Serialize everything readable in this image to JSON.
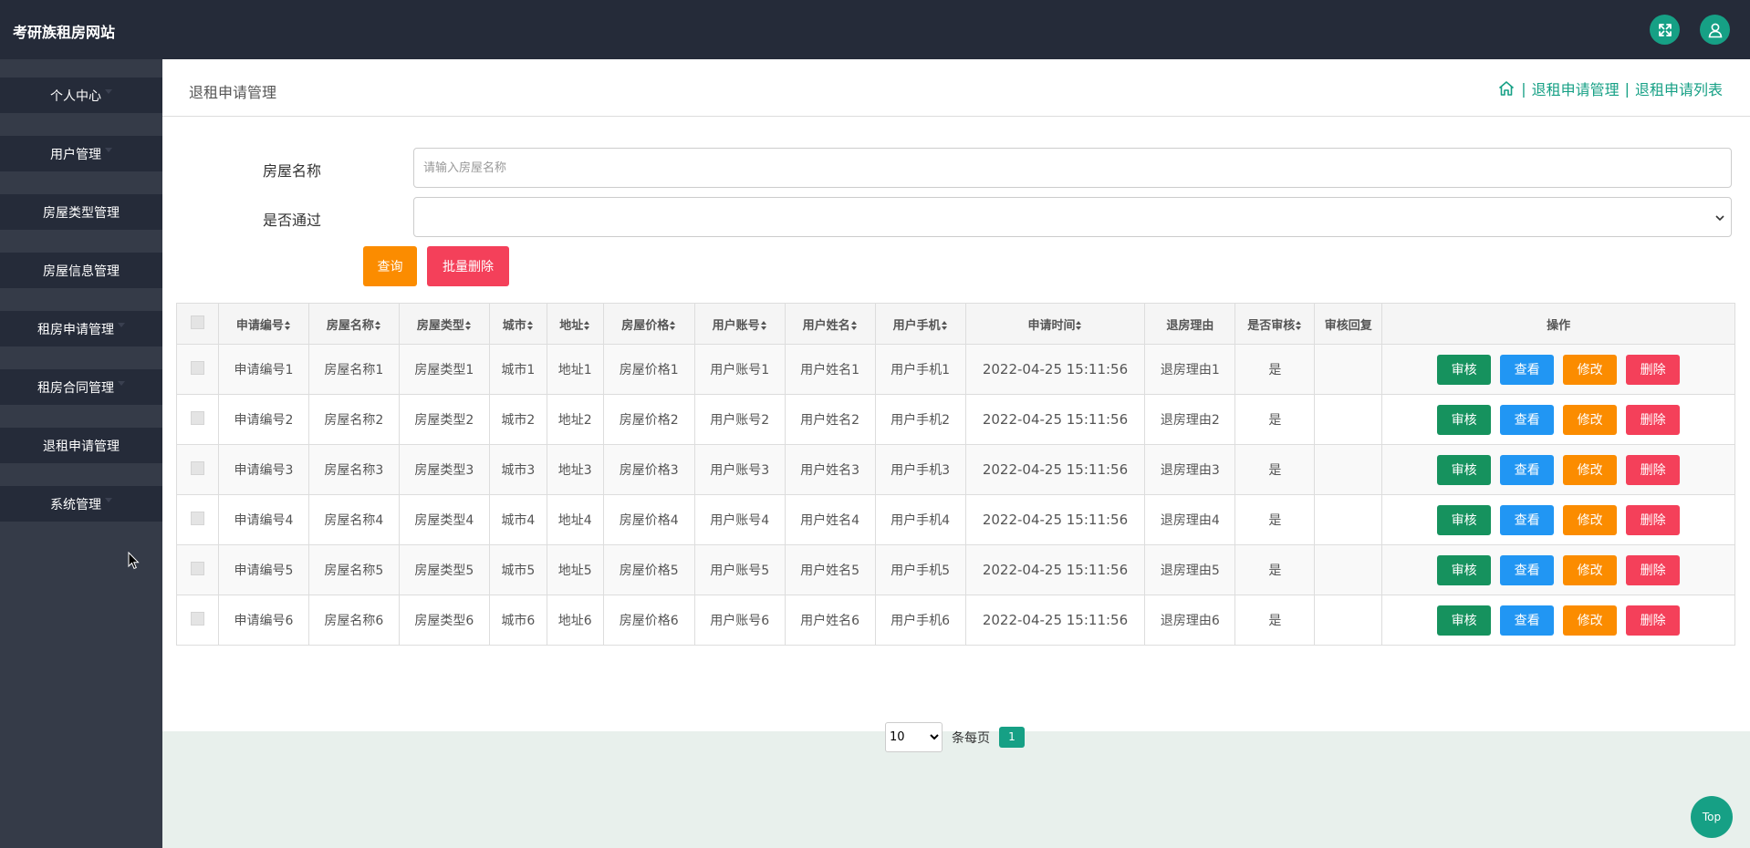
{
  "app": {
    "title": "考研族租房网站"
  },
  "sidebar": {
    "items": [
      {
        "label": "个人中心",
        "has_caret": true
      },
      {
        "label": "用户管理",
        "has_caret": true
      },
      {
        "label": "房屋类型管理",
        "has_caret": false
      },
      {
        "label": "房屋信息管理",
        "has_caret": false
      },
      {
        "label": "租房申请管理",
        "has_caret": true
      },
      {
        "label": "租房合同管理",
        "has_caret": true
      },
      {
        "label": "退租申请管理",
        "has_caret": false
      },
      {
        "label": "系统管理",
        "has_caret": true
      }
    ]
  },
  "page": {
    "title": "退租申请管理",
    "breadcrumb": {
      "sep": "|",
      "level1": "退租申请管理",
      "level2": "退租申请列表"
    }
  },
  "search": {
    "house_name_label": "房屋名称",
    "house_name_placeholder": "请输入房屋名称",
    "house_name_value": "",
    "approved_label": "是否通过",
    "approved_value": "",
    "query_button": "查询",
    "batch_delete_button": "批量删除"
  },
  "table": {
    "columns": [
      "申请编号",
      "房屋名称",
      "房屋类型",
      "城市",
      "地址",
      "房屋价格",
      "用户账号",
      "用户姓名",
      "用户手机",
      "申请时间",
      "退房理由",
      "是否审核",
      "审核回复",
      "操作"
    ],
    "actions": {
      "audit": "审核",
      "view": "查看",
      "edit": "修改",
      "delete": "删除"
    },
    "rows": [
      [
        "申请编号1",
        "房屋名称1",
        "房屋类型1",
        "城市1",
        "地址1",
        "房屋价格1",
        "用户账号1",
        "用户姓名1",
        "用户手机1",
        "2022-04-25 15:11:56",
        "退房理由1",
        "是",
        ""
      ],
      [
        "申请编号2",
        "房屋名称2",
        "房屋类型2",
        "城市2",
        "地址2",
        "房屋价格2",
        "用户账号2",
        "用户姓名2",
        "用户手机2",
        "2022-04-25 15:11:56",
        "退房理由2",
        "是",
        ""
      ],
      [
        "申请编号3",
        "房屋名称3",
        "房屋类型3",
        "城市3",
        "地址3",
        "房屋价格3",
        "用户账号3",
        "用户姓名3",
        "用户手机3",
        "2022-04-25 15:11:56",
        "退房理由3",
        "是",
        ""
      ],
      [
        "申请编号4",
        "房屋名称4",
        "房屋类型4",
        "城市4",
        "地址4",
        "房屋价格4",
        "用户账号4",
        "用户姓名4",
        "用户手机4",
        "2022-04-25 15:11:56",
        "退房理由4",
        "是",
        ""
      ],
      [
        "申请编号5",
        "房屋名称5",
        "房屋类型5",
        "城市5",
        "地址5",
        "房屋价格5",
        "用户账号5",
        "用户姓名5",
        "用户手机5",
        "2022-04-25 15:11:56",
        "退房理由5",
        "是",
        ""
      ],
      [
        "申请编号6",
        "房屋名称6",
        "房屋类型6",
        "城市6",
        "地址6",
        "房屋价格6",
        "用户账号6",
        "用户姓名6",
        "用户手机6",
        "2022-04-25 15:11:56",
        "退房理由6",
        "是",
        ""
      ]
    ]
  },
  "pager": {
    "page_size": "10",
    "page_size_label": "条每页",
    "current_page": "1"
  },
  "top_button": "Top",
  "icons": {
    "fullscreen": "fullscreen-icon",
    "user": "user-icon",
    "home": "home-icon"
  },
  "colors": {
    "accent": "#16a085",
    "topbar": "#252b39",
    "sidebar": "#353b48"
  }
}
